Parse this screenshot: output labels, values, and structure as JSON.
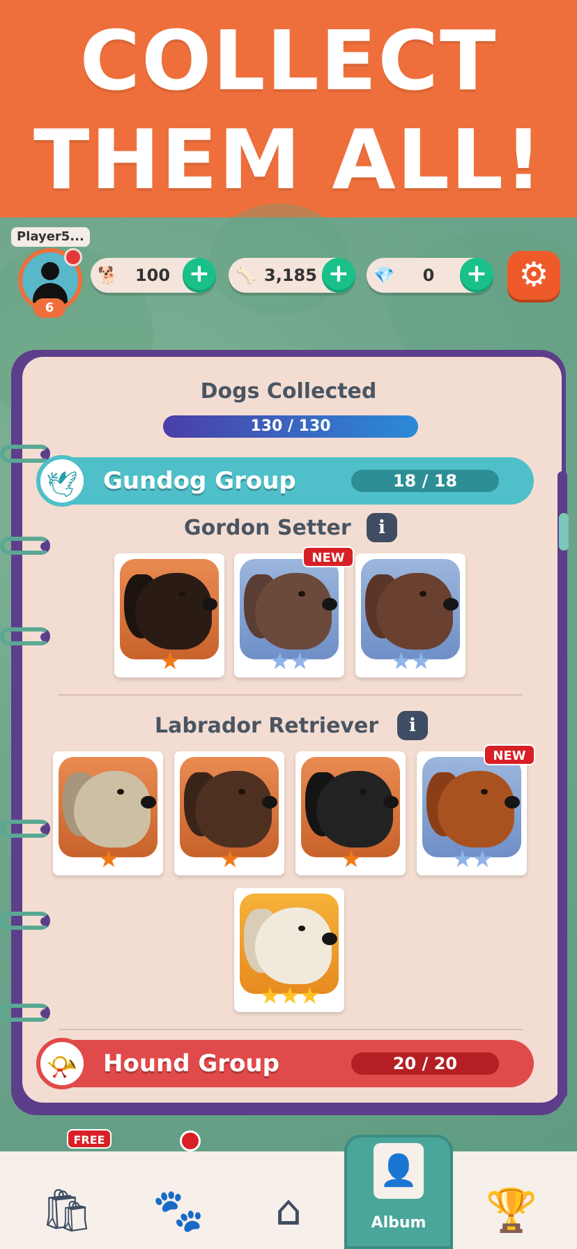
{
  "banner": {
    "line1": "COLLECT",
    "line2": "THEM ALL!"
  },
  "player": {
    "name": "Player5...",
    "level": "6"
  },
  "currencies": [
    {
      "icon": "dog-icon",
      "value": "100",
      "plus": "+"
    },
    {
      "icon": "bone-icon",
      "value": "3,185",
      "plus": "+"
    },
    {
      "icon": "diamond-icon",
      "value": "0",
      "plus": "+"
    }
  ],
  "settings": {
    "icon": "gear-icon"
  },
  "album": {
    "title": "Dogs Collected",
    "progress_text": "130 / 130",
    "progress_fraction": 1.0,
    "groups": [
      {
        "name": "Gundog Group",
        "count": "18 / 18",
        "icon": "bird-icon",
        "color": "#4fc0c9"
      },
      {
        "name": "Hound Group",
        "count": "20 / 20",
        "icon": "horn-icon",
        "color": "#e14a4a"
      }
    ],
    "breeds": [
      {
        "name": "Gordon Setter",
        "info": "i",
        "cards": [
          {
            "rarity": "orange",
            "stars": "★",
            "new": ""
          },
          {
            "rarity": "blue",
            "stars": "★★",
            "new": "NEW"
          },
          {
            "rarity": "blue",
            "stars": "★★",
            "new": ""
          }
        ]
      },
      {
        "name": "Labrador Retriever",
        "info": "i",
        "cards": [
          {
            "rarity": "orange",
            "stars": "★",
            "new": ""
          },
          {
            "rarity": "orange",
            "stars": "★",
            "new": ""
          },
          {
            "rarity": "orange",
            "stars": "★",
            "new": ""
          },
          {
            "rarity": "blue",
            "stars": "★★",
            "new": "NEW"
          },
          {
            "rarity": "gold",
            "stars": "★★★",
            "new": ""
          }
        ]
      }
    ]
  },
  "bottom_nav": {
    "free_badge": "FREE",
    "items": [
      {
        "icon": "shop-bag-icon"
      },
      {
        "icon": "paw-icon"
      },
      {
        "icon": "home-icon"
      },
      {
        "icon": "album-icon",
        "label": "Album"
      },
      {
        "icon": "trophy-icon"
      }
    ]
  }
}
